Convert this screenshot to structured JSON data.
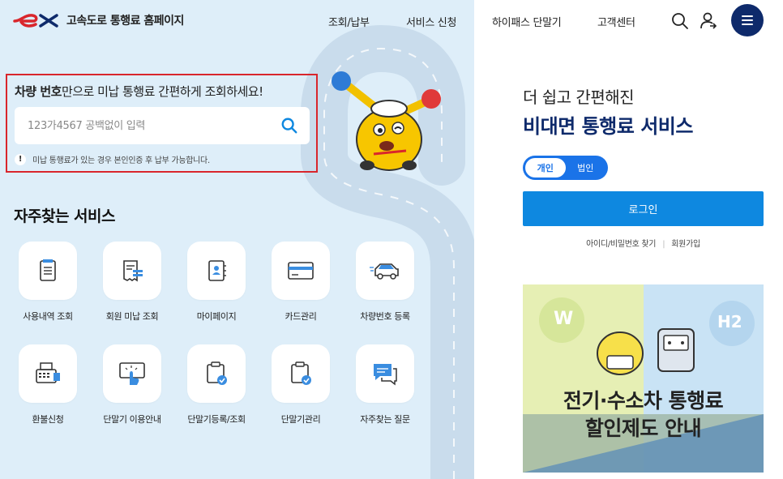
{
  "header": {
    "logo_text": "고속도로 통행료 홈페이지",
    "nav": [
      "조회/납부",
      "서비스 신청",
      "하이패스 단말기",
      "고객센터"
    ]
  },
  "search": {
    "title_bold": "차량 번호",
    "title_rest": "만으로 미납 통행료 간편하게 조회하세요!",
    "placeholder": "123가4567 공백없이 입력",
    "notice": "미납 통행료가 있는 경우 본인인증 후 납부 가능합니다.",
    "notice_icon": "!"
  },
  "services": {
    "title": "자주찾는 서비스",
    "items": [
      {
        "label": "사용내역 조회",
        "icon": "document-list-icon"
      },
      {
        "label": "회원 미납 조회",
        "icon": "receipt-icon"
      },
      {
        "label": "마이페이지",
        "icon": "user-book-icon"
      },
      {
        "label": "카드관리",
        "icon": "card-icon"
      },
      {
        "label": "차량번호 등록",
        "icon": "car-icon"
      },
      {
        "label": "환불신청",
        "icon": "printer-icon"
      },
      {
        "label": "단말기 이용안내",
        "icon": "touch-icon"
      },
      {
        "label": "단말기등록/조회",
        "icon": "clipboard-check-icon"
      },
      {
        "label": "단말기관리",
        "icon": "clipboard-check-icon"
      },
      {
        "label": "자주찾는 질문",
        "icon": "chat-icon"
      }
    ]
  },
  "right": {
    "promo_line1": "더 쉽고 간편해진",
    "promo_line2": "비대면 통행료 서비스",
    "toggle_on": "개인",
    "toggle_off": "법인",
    "login": "로그인",
    "link_find": "아이디/비밀번호 찾기",
    "link_join": "회원가입",
    "banner_line1": "전기·수소차 통행료",
    "banner_line2": "할인제도 안내",
    "banner_badge_left": "W",
    "banner_badge_right": "H2"
  },
  "colors": {
    "brand_navy": "#0e2a6b",
    "brand_blue": "#0e88e0",
    "brand_red": "#d9262c",
    "left_bg": "#deeef9"
  }
}
